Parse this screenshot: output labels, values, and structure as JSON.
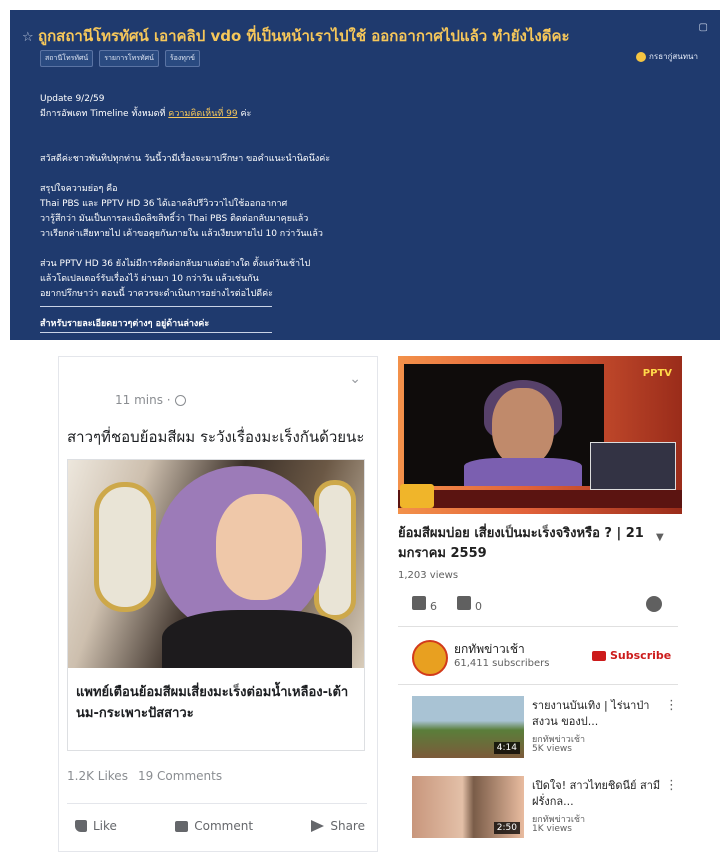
{
  "forum": {
    "title": "ถูกสถานีโทรทัศน์ เอาคลิป vdo ที่เป็นหน้าเราไปใช้ ออกอากาศไปแล้ว ทำยังไงดีคะ",
    "tags": [
      "สถานีโทรทัศน์",
      "รายการโทรทัศน์",
      "ร้องทุกข์"
    ],
    "feeling": "กรธากู่สนทนา",
    "update_date": "Update 9/2/59",
    "timeline_prefix": "มีการอัพเดท Timeline ทั้งหมดที่",
    "timeline_link": "ความคิดเห็นที่ 99",
    "timeline_suffix": "ค่ะ",
    "greeting": "สวัสดีค่ะชาวพันทิปทุกท่าน วันนี้วามีเรื่องจะมาปรึกษา ขอคำแนะนำนิดนึงค่ะ",
    "summary_heading": "สรุปใจความย่อๆ คือ",
    "summary_lines": [
      "Thai PBS และ PPTV HD 36 ได้เอาคลิปรีวิววาไปใช้ออกอากาศ",
      "วารู้สึกว่า มันเป็นการละเมิดลิขสิทธิ์ว่า Thai PBS ติดต่อกลับมาคุยแล้ว",
      "วาเรียกค่าเสียหายไป เค้าขอคุยกันภายใน แล้วเงียบหายไป 10 กว่าวันแล้ว"
    ],
    "pptv_lines": [
      "ส่วน PPTV HD 36 ยังไม่มีการติดต่อกลับมาแต่อย่างใด ตั้งแต่วันเช้าไป",
      "แล้วโดเปลเตอร์รับเรื่องไว้ ผ่านมา 10 กว่าวัน แล้วเช่นกัน",
      "อยากปรึกษาว่า ตอนนี้ วาควรจะดำเนินการอย่างไรต่อไปดีค่ะ"
    ],
    "footer_note": "สำหรับรายละเอียดยาวๆต่างๆ อยู่ด้านล่างค่ะ"
  },
  "facebook_post": {
    "time": "11 mins ·",
    "headline": "สาวๆที่ชอบย้อมสีผม ระวังเรื่องมะเร็งกันด้วยนะ",
    "card_title": "แพทย์เตือนย้อมสีผมเสี่ยงมะเร็งต่อมน้ำเหลือง-เต้านม-กระเพาะปัสสาวะ",
    "likes": "1.2K Likes",
    "comments": "19 Comments",
    "actions": {
      "like": "Like",
      "comment": "Comment",
      "share": "Share"
    }
  },
  "youtube": {
    "player_logo": "PPTV",
    "title": "ย้อมสีผมบ่อย เสี่ยงเป็นมะเร็งจริงหรือ ? | 21 มกราคม 2559",
    "views": "1,203 views",
    "likes": "6",
    "dislikes": "0",
    "channel": {
      "name": "ยกทัพข่าวเช้า",
      "subscribers": "61,411 subscribers",
      "subscribe": "Subscribe"
    },
    "related": [
      {
        "title": "รายงานบันเทิง | ไร่นาป่าสงวน ของป...",
        "channel": "ยกทัพข่าวเช้า",
        "views": "5K views",
        "duration": "4:14"
      },
      {
        "title": "เปิดใจ! สาวไทยชิดนีย์ สามีฝรั่งกล...",
        "channel": "ยกทัพข่าวเช้า",
        "views": "1K views",
        "duration": "2:50"
      }
    ]
  }
}
